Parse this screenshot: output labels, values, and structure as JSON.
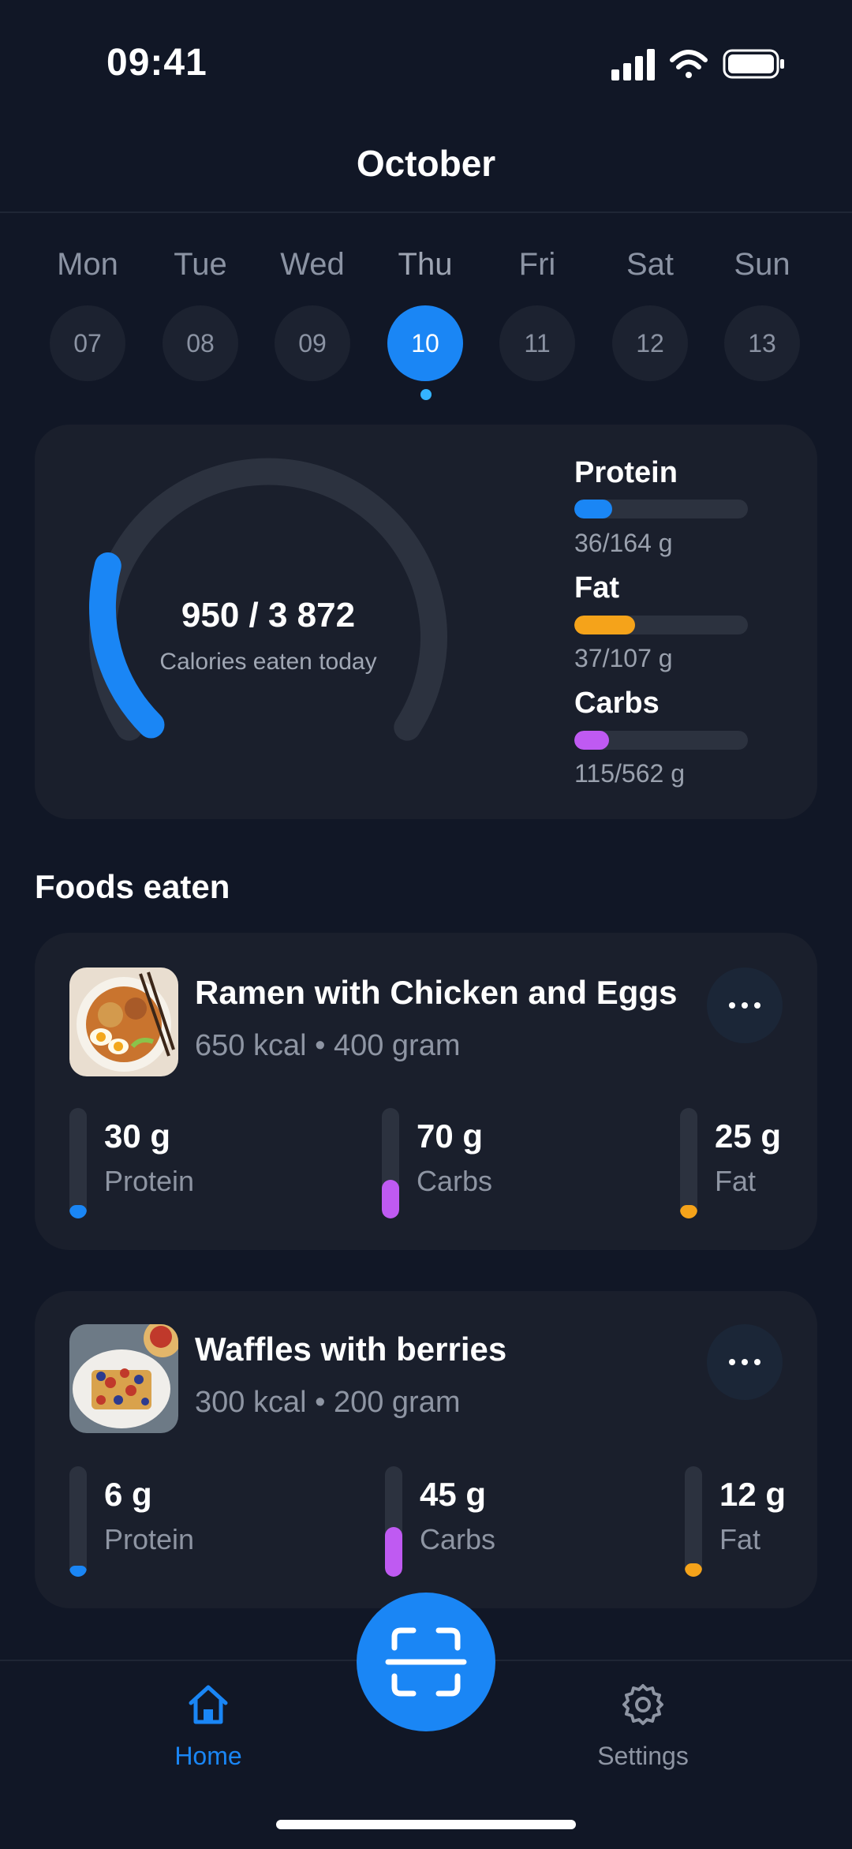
{
  "status_bar": {
    "time": "09:41"
  },
  "header": {
    "month": "October"
  },
  "week": {
    "days": [
      {
        "name": "Mon",
        "num": "07"
      },
      {
        "name": "Tue",
        "num": "08"
      },
      {
        "name": "Wed",
        "num": "09"
      },
      {
        "name": "Thu",
        "num": "10"
      },
      {
        "name": "Fri",
        "num": "11"
      },
      {
        "name": "Sat",
        "num": "12"
      },
      {
        "name": "Sun",
        "num": "13"
      }
    ],
    "active_index": 3
  },
  "summary": {
    "calories_text": "950 / 3 872",
    "calories_eaten": 950,
    "calories_goal": 3872,
    "calories_label": "Calories eaten today",
    "macros": [
      {
        "name": "Protein",
        "value_text": "36/164 g",
        "progress": 0.22,
        "color": "#1a86f5"
      },
      {
        "name": "Fat",
        "value_text": "37/107 g",
        "progress": 0.35,
        "color": "#f5a31a"
      },
      {
        "name": "Carbs",
        "value_text": "115/562 g",
        "progress": 0.2,
        "color": "#bf5af2"
      }
    ]
  },
  "foods": {
    "title": "Foods eaten",
    "items": [
      {
        "name": "Ramen with Chicken and Eggs",
        "meta": "650 kcal • 400 gram",
        "nutrients": [
          {
            "value": "30 g",
            "label": "Protein",
            "level": 0.12,
            "color": "#1a86f5"
          },
          {
            "value": "70 g",
            "label": "Carbs",
            "level": 0.35,
            "color": "#bf5af2"
          },
          {
            "value": "25 g",
            "label": "Fat",
            "level": 0.12,
            "color": "#f5a31a"
          }
        ]
      },
      {
        "name": "Waffles with berries",
        "meta": "300 kcal • 200 gram",
        "nutrients": [
          {
            "value": "6 g",
            "label": "Protein",
            "level": 0.1,
            "color": "#1a86f5"
          },
          {
            "value": "45 g",
            "label": "Carbs",
            "level": 0.45,
            "color": "#bf5af2"
          },
          {
            "value": "12 g",
            "label": "Fat",
            "level": 0.12,
            "color": "#f5a31a"
          }
        ]
      }
    ]
  },
  "nav": {
    "home_label": "Home",
    "settings_label": "Settings",
    "active_color": "#1a86f5",
    "inactive_color": "#8e95a3"
  },
  "icons": {
    "status": [
      "cellular-signal-icon",
      "wifi-icon",
      "battery-icon"
    ],
    "scan": "scan-icon",
    "home": "home-icon",
    "settings": "gear-icon",
    "more": "more-icon"
  }
}
